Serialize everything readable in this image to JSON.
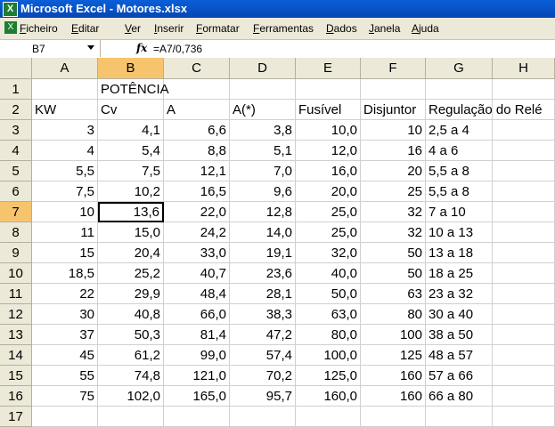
{
  "window": {
    "title": "Microsoft Excel - Motores.xlsx"
  },
  "menu": [
    "Ficheiro",
    "Editar",
    "Ver",
    "Inserir",
    "Formatar",
    "Ferramentas",
    "Dados",
    "Janela",
    "Ajuda"
  ],
  "formula_bar": {
    "cell_ref": "B7",
    "fx_label": "fx",
    "formula": "=A7/0,736"
  },
  "columns": [
    "A",
    "B",
    "C",
    "D",
    "E",
    "F",
    "G",
    "H"
  ],
  "selected_cell": {
    "col": "B",
    "row": 7
  },
  "rows": [
    [
      "",
      "POTÊNCIA",
      "",
      "",
      "",
      "",
      "",
      ""
    ],
    [
      "KW",
      "Cv",
      "A",
      "A(*)",
      "Fusível",
      "Disjuntor",
      "Regulação do Relé",
      ""
    ],
    [
      "3",
      "4,1",
      "6,6",
      "3,8",
      "10,0",
      "10",
      "2,5 a 4",
      ""
    ],
    [
      "4",
      "5,4",
      "8,8",
      "5,1",
      "12,0",
      "16",
      "4 a 6",
      ""
    ],
    [
      "5,5",
      "7,5",
      "12,1",
      "7,0",
      "16,0",
      "20",
      "5,5 a 8",
      ""
    ],
    [
      "7,5",
      "10,2",
      "16,5",
      "9,6",
      "20,0",
      "25",
      "5,5 a 8",
      ""
    ],
    [
      "10",
      "13,6",
      "22,0",
      "12,8",
      "25,0",
      "32",
      "7 a 10",
      ""
    ],
    [
      "11",
      "15,0",
      "24,2",
      "14,0",
      "25,0",
      "32",
      "10 a 13",
      ""
    ],
    [
      "15",
      "20,4",
      "33,0",
      "19,1",
      "32,0",
      "50",
      "13 a 18",
      ""
    ],
    [
      "18,5",
      "25,2",
      "40,7",
      "23,6",
      "40,0",
      "50",
      "18 a 25",
      ""
    ],
    [
      "22",
      "29,9",
      "48,4",
      "28,1",
      "50,0",
      "63",
      "23 a 32",
      ""
    ],
    [
      "30",
      "40,8",
      "66,0",
      "38,3",
      "63,0",
      "80",
      "30 a 40",
      ""
    ],
    [
      "37",
      "50,3",
      "81,4",
      "47,2",
      "80,0",
      "100",
      "38 a 50",
      ""
    ],
    [
      "45",
      "61,2",
      "99,0",
      "57,4",
      "100,0",
      "125",
      "48 a 57",
      ""
    ],
    [
      "55",
      "74,8",
      "121,0",
      "70,2",
      "125,0",
      "160",
      "57 a 66",
      ""
    ],
    [
      "75",
      "102,0",
      "165,0",
      "95,7",
      "160,0",
      "160",
      "66 a 80",
      ""
    ],
    [
      "",
      "",
      "",
      "",
      "",
      "",
      "",
      ""
    ]
  ]
}
